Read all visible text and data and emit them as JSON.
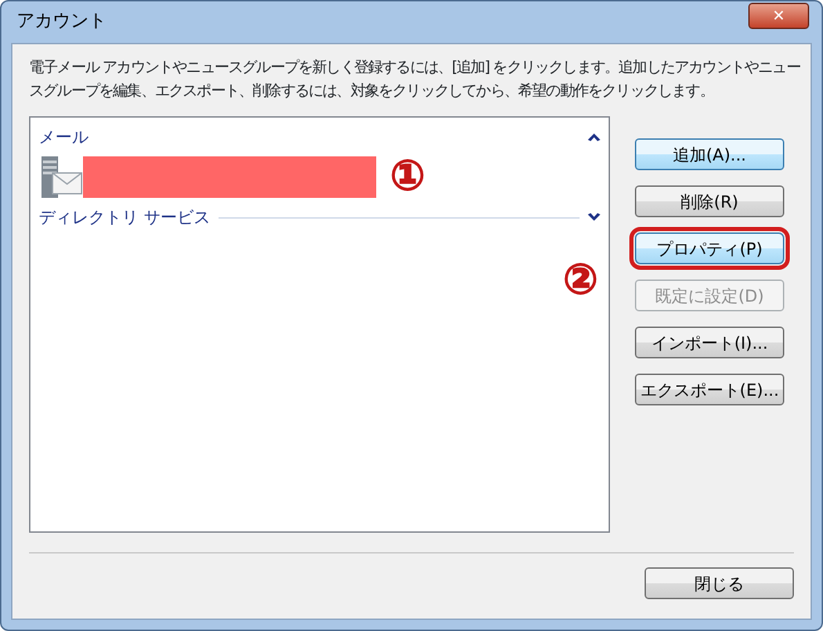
{
  "window": {
    "title": "アカウント",
    "close_glyph": "✕"
  },
  "description": "電子メール アカウントやニュースグループを新しく登録するには、[追加] をクリックします。追加したアカウントやニュースグループを編集、エクスポート、削除するには、対象をクリックしてから、希望の動作をクリックします。",
  "groups": [
    {
      "label": "メール",
      "expanded": true,
      "items": [
        {
          "kind": "account"
        }
      ]
    },
    {
      "label": "ディレクトリ サービス",
      "expanded": false
    }
  ],
  "buttons": [
    {
      "label": "追加(A)...",
      "disabled": false,
      "highlighted": true,
      "annotated": false
    },
    {
      "label": "削除(R)",
      "disabled": false,
      "highlighted": false,
      "annotated": false
    },
    {
      "label": "プロパティ(P)",
      "disabled": false,
      "highlighted": true,
      "annotated": true
    },
    {
      "label": "既定に設定(D)",
      "disabled": true,
      "highlighted": false,
      "annotated": false
    },
    {
      "label": "インポート(I)...",
      "disabled": false,
      "highlighted": false,
      "annotated": false
    },
    {
      "label": "エクスポート(E)...",
      "disabled": false,
      "highlighted": false,
      "annotated": false
    }
  ],
  "annotations": [
    "①",
    "②"
  ],
  "close_button": {
    "label": "閉じる"
  }
}
